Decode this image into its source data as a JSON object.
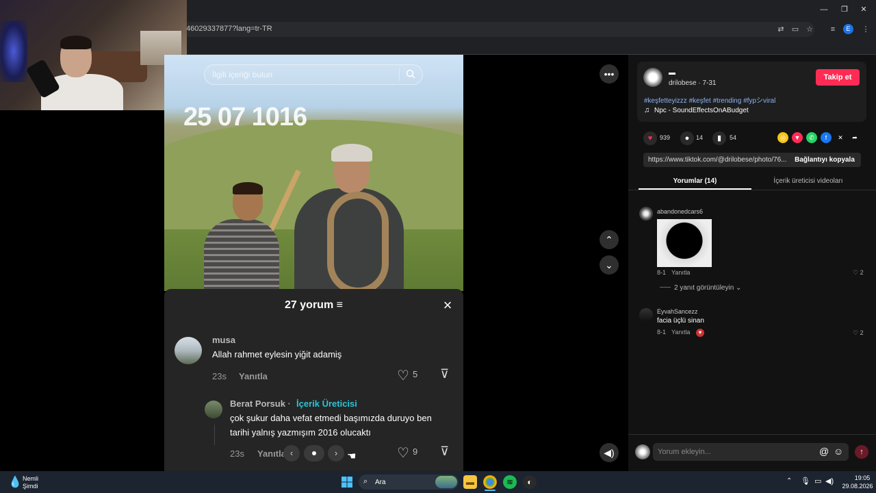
{
  "browser": {
    "url": "46029337877?lang=tr-TR",
    "window_controls": {
      "minimize": "—",
      "restore": "❐",
      "close": "✕"
    },
    "toolbar_icons": [
      "translate-icon",
      "install-icon",
      "star-icon",
      "media-icon",
      "profile-icon",
      "menu-icon"
    ],
    "profile_letter": "E"
  },
  "video": {
    "search_placeholder": "İlgili içeriği bulun",
    "overlay_date": "25 07 1016"
  },
  "comment_sheet": {
    "title": "27 yorum",
    "comments": [
      {
        "user": "musa",
        "text": "Allah rahmet eylesin yiğit adamiş",
        "time": "23s",
        "reply_label": "Yanıtla",
        "likes": "5"
      },
      {
        "user": "Berat Porsuk",
        "separator": "·",
        "badge": "İçerik Üreticisi",
        "text_line1": "çok şukur daha vefat etmedi başımızda duruyo ben",
        "text_line2": "tarihi yalnış yazmışım 2016 olucaktı",
        "time": "23s",
        "reply_label": "Yanıtla",
        "likes": "9"
      }
    ]
  },
  "post": {
    "author_nick": "▬",
    "author_line": "drilobese · 7-31",
    "follow_label": "Takip et",
    "hashtags": "#keşfetteyizzz #keşfet #trending #fypシviral",
    "music_note": "♫",
    "music": "Npc - SoundEffectsOnABudget",
    "likes": "939",
    "comments": "14",
    "saves": "54",
    "link": "https://www.tiktok.com/@drilobese/photo/76...",
    "copy_label": "Bağlantıyı kopyala",
    "tabs": [
      "Yorumlar (14)",
      "İçerik üreticisi videoları"
    ]
  },
  "side_comments": [
    {
      "user": "abandonedcars6",
      "date": "8-1",
      "reply_label": "Yanıtla",
      "likes": "♡ 2",
      "view_replies": "2 yanıt görüntüleyin ⌄"
    },
    {
      "user": "EyvahSancezz",
      "text": "facia üçlü sinan",
      "date": "8-1",
      "reply_label": "Yanıtla",
      "likes": "♡ 2"
    }
  ],
  "comment_input": {
    "placeholder": "Yorum ekleyin...",
    "at": "@",
    "emoji": "☺",
    "send": "↑"
  },
  "taskbar": {
    "weather_title": "Nemli",
    "weather_sub": "Şimdi",
    "search_text": "Ara",
    "time": "19:05",
    "date": "29.08.2026"
  },
  "colors": {
    "accent": "#fe2c55",
    "creator_badge": "#27c7d7",
    "link": "#8ab4f8"
  }
}
